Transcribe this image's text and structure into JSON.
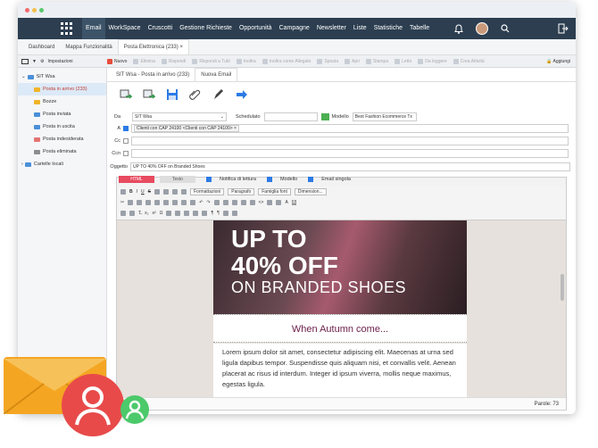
{
  "topnav": {
    "items": [
      "Email",
      "WorkSpace",
      "Cruscotti",
      "Gestione Richieste",
      "Opportunità",
      "Campagne",
      "Newsletter",
      "Liste",
      "Statistiche",
      "Tabelle"
    ]
  },
  "tabs": {
    "items": [
      "Dashboard",
      "Mappa Funzionalità",
      "Posta Elettronica (233)"
    ]
  },
  "toolbar": {
    "settings": "Impostazioni",
    "items": [
      "Nuovo",
      "Elimina",
      "Rispondi",
      "Rispondi a Tutti",
      "Inoltra",
      "Inoltra come Allegato",
      "Sposta",
      "Apri",
      "Stampa",
      "Letto",
      "Da leggere",
      "Crea Attività"
    ],
    "add": "Aggiungi"
  },
  "sidebar": {
    "account": "SIT Wsa",
    "folders": [
      "Posta in arrivo (233)",
      "Bozze",
      "Posta inviata",
      "Posta in uscita",
      "Posta indesiderata",
      "Posta eliminata"
    ],
    "local": "Cartelle locali"
  },
  "content": {
    "tabs": [
      "SIT Wsa - Posta in arrivo (233)",
      "Nuova Email"
    ],
    "labels": {
      "da": "Da",
      "a": "A",
      "cc": "Cc",
      "ccn": "Ccn",
      "oggetto": "Oggetto",
      "scheduled": "Schedulato",
      "modello": "Modello"
    },
    "da_value": "SIT Wsa",
    "modello_value": "Best Fashion Ecommerce Tx",
    "recipient": "Clienti con CAP 24100 <Clienti con CAP 24100>",
    "subject": "UP TO 40% OFF on Branded Shoes"
  },
  "editor": {
    "tabs": [
      "HTML",
      "Testo"
    ],
    "checks": [
      "Notifica di lettura",
      "Modello",
      "Email singola"
    ],
    "rte": {
      "formats": "Formattazioni",
      "paragraph": "Paragrafo",
      "font": "Famiglia font",
      "size": "Dimension..."
    },
    "hero_line1": "UP TO",
    "hero_line2": "40% OFF",
    "hero_line3": "ON BRANDED SHOES",
    "heading": "When Autumn come...",
    "body": "Lorem ipsum dolor sit amet, consectetur adipiscing elit. Maecenas at urna sed ligula dapibus tempor. Suspendisse quis aliquam nisi, et convallis velit. Aenean placerat ac risus id interdum. Integer id ipsum viverra, mollis neque maximus, egestas ligula.",
    "status": "Parole: 73"
  },
  "colors": {
    "accent": "#e84a5f",
    "nav": "#2c3e50",
    "heading": "#6b1e4a"
  }
}
